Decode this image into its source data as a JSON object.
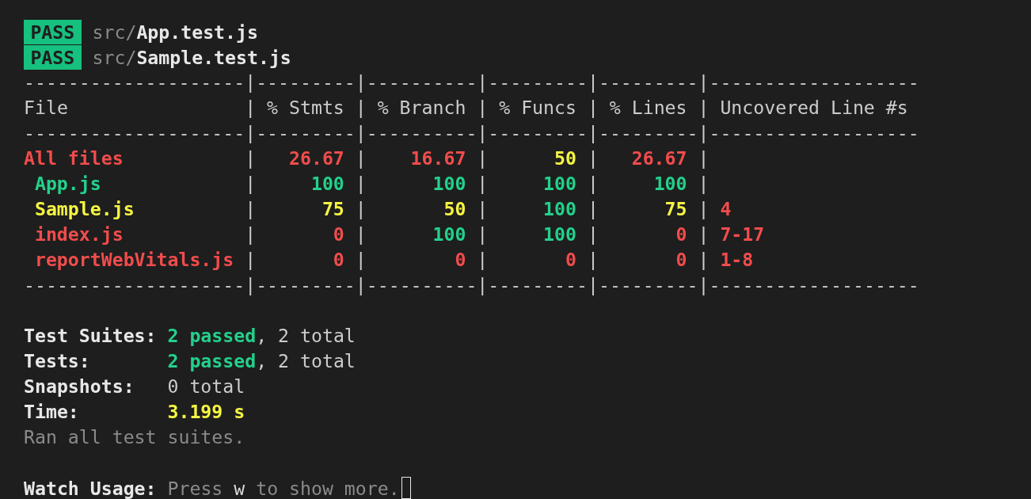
{
  "test_results": [
    {
      "status": "PASS",
      "path": "src/**App.test.js**"
    },
    {
      "status": "PASS",
      "path": "src/**Sample.test.js**"
    }
  ],
  "coverage_table": {
    "top_rule": "--------------------|---------|----------|---------|---------|-------------------",
    "separator": "|",
    "columns": [
      "File",
      "% Stmts",
      "% Branch",
      "% Funcs",
      "% Lines",
      "Uncovered Line #s"
    ],
    "header_rule": "--------------------|---------|----------|---------|---------|-------------------",
    "rows": [
      {
        "cells": [
          {
            "text": "All files",
            "color": "#f14c4c"
          },
          {
            "text": "26.67",
            "color": "#f14c4c"
          },
          {
            "text": "16.67",
            "color": "#f14c4c"
          },
          {
            "text": "50",
            "color": "#f5f543"
          },
          {
            "text": "26.67",
            "color": "#f14c4c"
          }
        ],
        "children": [
          {
            "cells": [
              {
                "text": "App.js",
                "color": "#23d18b"
              },
              {
                "text": "100",
                "color": "#23d18b"
              },
              {
                "text": "100",
                "color": "#23d18b"
              },
              {
                "text": "100",
                "color": "#23d18b"
              },
              {
                "text": "100",
                "color": "#23d18b"
              }
            ]
          },
          {
            "cells": [
              {
                "text": "Sample.js",
                "color": "#f5f543"
              },
              {
                "text": "75",
                "color": "#f5f543"
              },
              {
                "text": "50",
                "color": "#f5f543"
              },
              {
                "text": "100",
                "color": "#23d18b"
              },
              {
                "text": "75",
                "color": "#f5f543"
              },
              {
                "text": "4",
                "color": "#f14c4c"
              }
            ]
          },
          {
            "cells": [
              {
                "text": "index.js",
                "color": "#f14c4c"
              },
              {
                "text": "0",
                "color": "#f14c4c"
              },
              {
                "text": "100",
                "color": "#23d18b"
              },
              {
                "text": "100",
                "color": "#23d18b"
              },
              {
                "text": "0",
                "color": "#f14c4c"
              },
              {
                "text": "7-17",
                "color": "#f14c4c"
              }
            ]
          },
          {
            "cells": [
              {
                "text": "reportWebVitals.js",
                "color": "#f14c4c"
              },
              {
                "text": "0",
                "color": "#f14c4c"
              },
              {
                "text": "0",
                "color": "#f14c4c"
              },
              {
                "text": "0",
                "color": "#f14c4c"
              },
              {
                "text": "0",
                "color": "#f14c4c"
              },
              {
                "text": "1-8",
                "color": "#f14c4c"
              }
            ]
          }
        ]
      }
    ],
    "bottom_rule": "--------------------|---------|----------|---------|---------|-------------------"
  },
  "summary": [
    {
      "kind": "count",
      "label": "Test Suites:",
      "passed": "2 passed",
      "total": ", 2 total"
    },
    {
      "kind": "count",
      "label": "Tests:",
      "passed": "2 passed",
      "total": ", 2 total"
    },
    {
      "kind": "count",
      "label": "Snapshots:",
      "total": "0 total"
    },
    {
      "kind": "time",
      "label": "Time:",
      "value": "3.199 s"
    }
  ],
  "ran_message": "Ran all test suites.",
  "watch_usage": {
    "label": "Watch Usage:",
    "hint": "Press **w** to show more."
  }
}
